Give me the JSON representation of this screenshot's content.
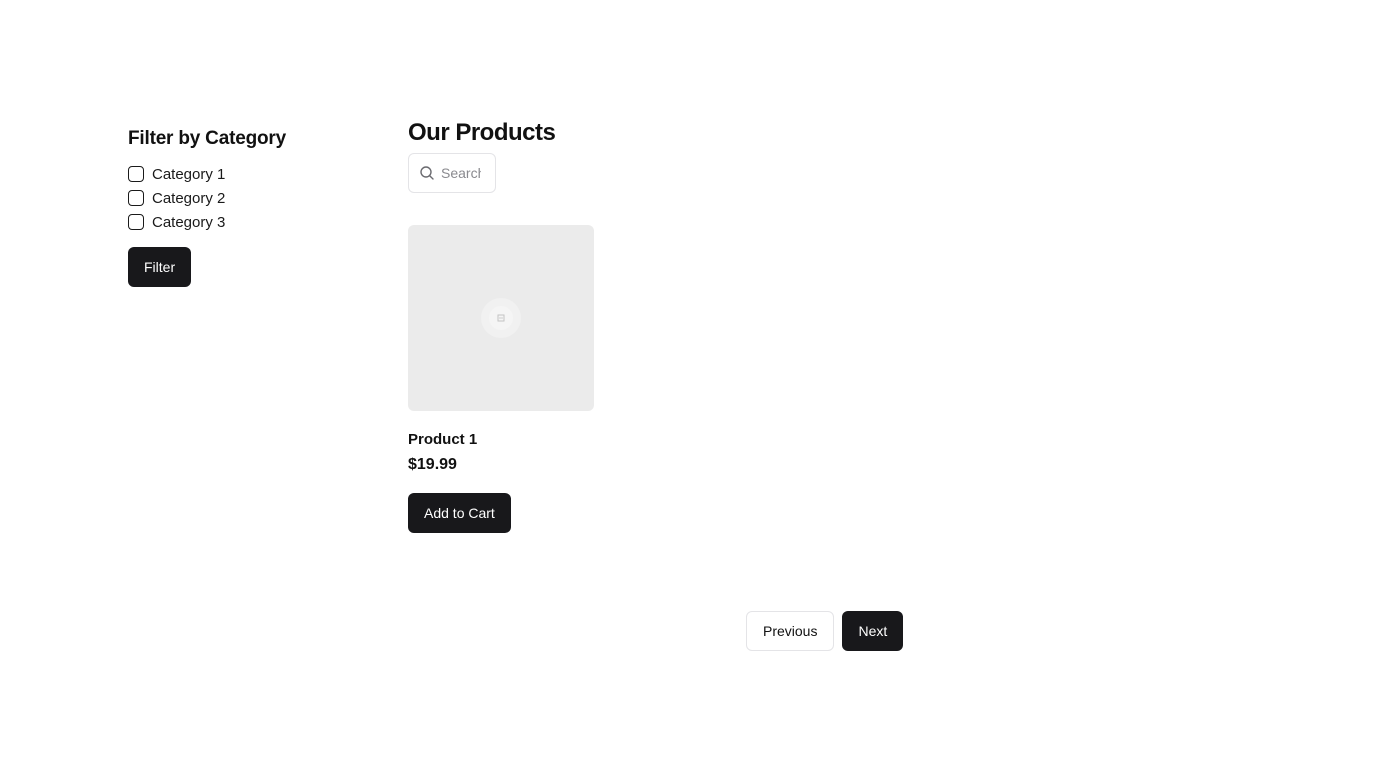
{
  "sidebar": {
    "title": "Filter by Category",
    "categories": [
      {
        "label": "Category 1",
        "checked": false
      },
      {
        "label": "Category 2",
        "checked": false
      },
      {
        "label": "Category 3",
        "checked": false
      }
    ],
    "filter_label": "Filter"
  },
  "main": {
    "title": "Our Products",
    "search": {
      "placeholder": "Search",
      "value": "",
      "icon": "search-icon"
    },
    "products": [
      {
        "name": "Product 1",
        "price": "$19.99",
        "image_icon": "image-placeholder-icon",
        "add_label": "Add to Cart"
      }
    ]
  },
  "pagination": {
    "previous_label": "Previous",
    "next_label": "Next"
  },
  "colors": {
    "primary": "#18181b",
    "image_placeholder": "#ebebeb",
    "border": "#e4e4e7"
  }
}
